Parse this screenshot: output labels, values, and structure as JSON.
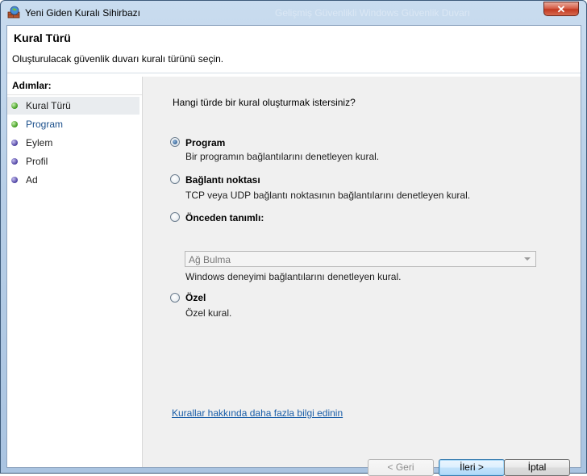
{
  "window": {
    "title": "Yeni Giden Kuralı Sihirbazı",
    "background_title": "Gelişmiş Güvenlikli Windows Güvenlik Duvarı",
    "close_glyph": "✕"
  },
  "header": {
    "title": "Kural Türü",
    "description": "Oluşturulacak güvenlik duvarı kuralı türünü seçin."
  },
  "steps": {
    "title": "Adımlar:",
    "items": [
      {
        "label": "Kural Türü",
        "state": "current",
        "dot_color": "#3c9a1a"
      },
      {
        "label": "Program",
        "state": "pending",
        "dot_color": "#3c9a1a"
      },
      {
        "label": "Eylem",
        "state": "pending",
        "dot_color": "#4a3fa0"
      },
      {
        "label": "Profil",
        "state": "pending",
        "dot_color": "#4a3fa0"
      },
      {
        "label": "Ad",
        "state": "pending",
        "dot_color": "#4a3fa0"
      }
    ]
  },
  "main": {
    "question": "Hangi türde bir kural oluşturmak istersiniz?",
    "options": [
      {
        "label": "Program",
        "description": "Bir programın bağlantılarını denetleyen kural.",
        "selected": true
      },
      {
        "label": "Bağlantı noktası",
        "description": "TCP veya UDP bağlantı noktasının bağlantılarını denetleyen kural.",
        "selected": false
      },
      {
        "label": "Önceden tanımlı:",
        "description": "Windows deneyimi bağlantılarını denetleyen kural.",
        "selected": false,
        "combo_value": "Ağ Bulma"
      },
      {
        "label": "Özel",
        "description": "Özel kural.",
        "selected": false
      }
    ],
    "help_link": "Kurallar hakkında daha fazla bilgi edinin"
  },
  "buttons": {
    "back": "< Geri",
    "next": "İleri >",
    "cancel": "İptal"
  }
}
